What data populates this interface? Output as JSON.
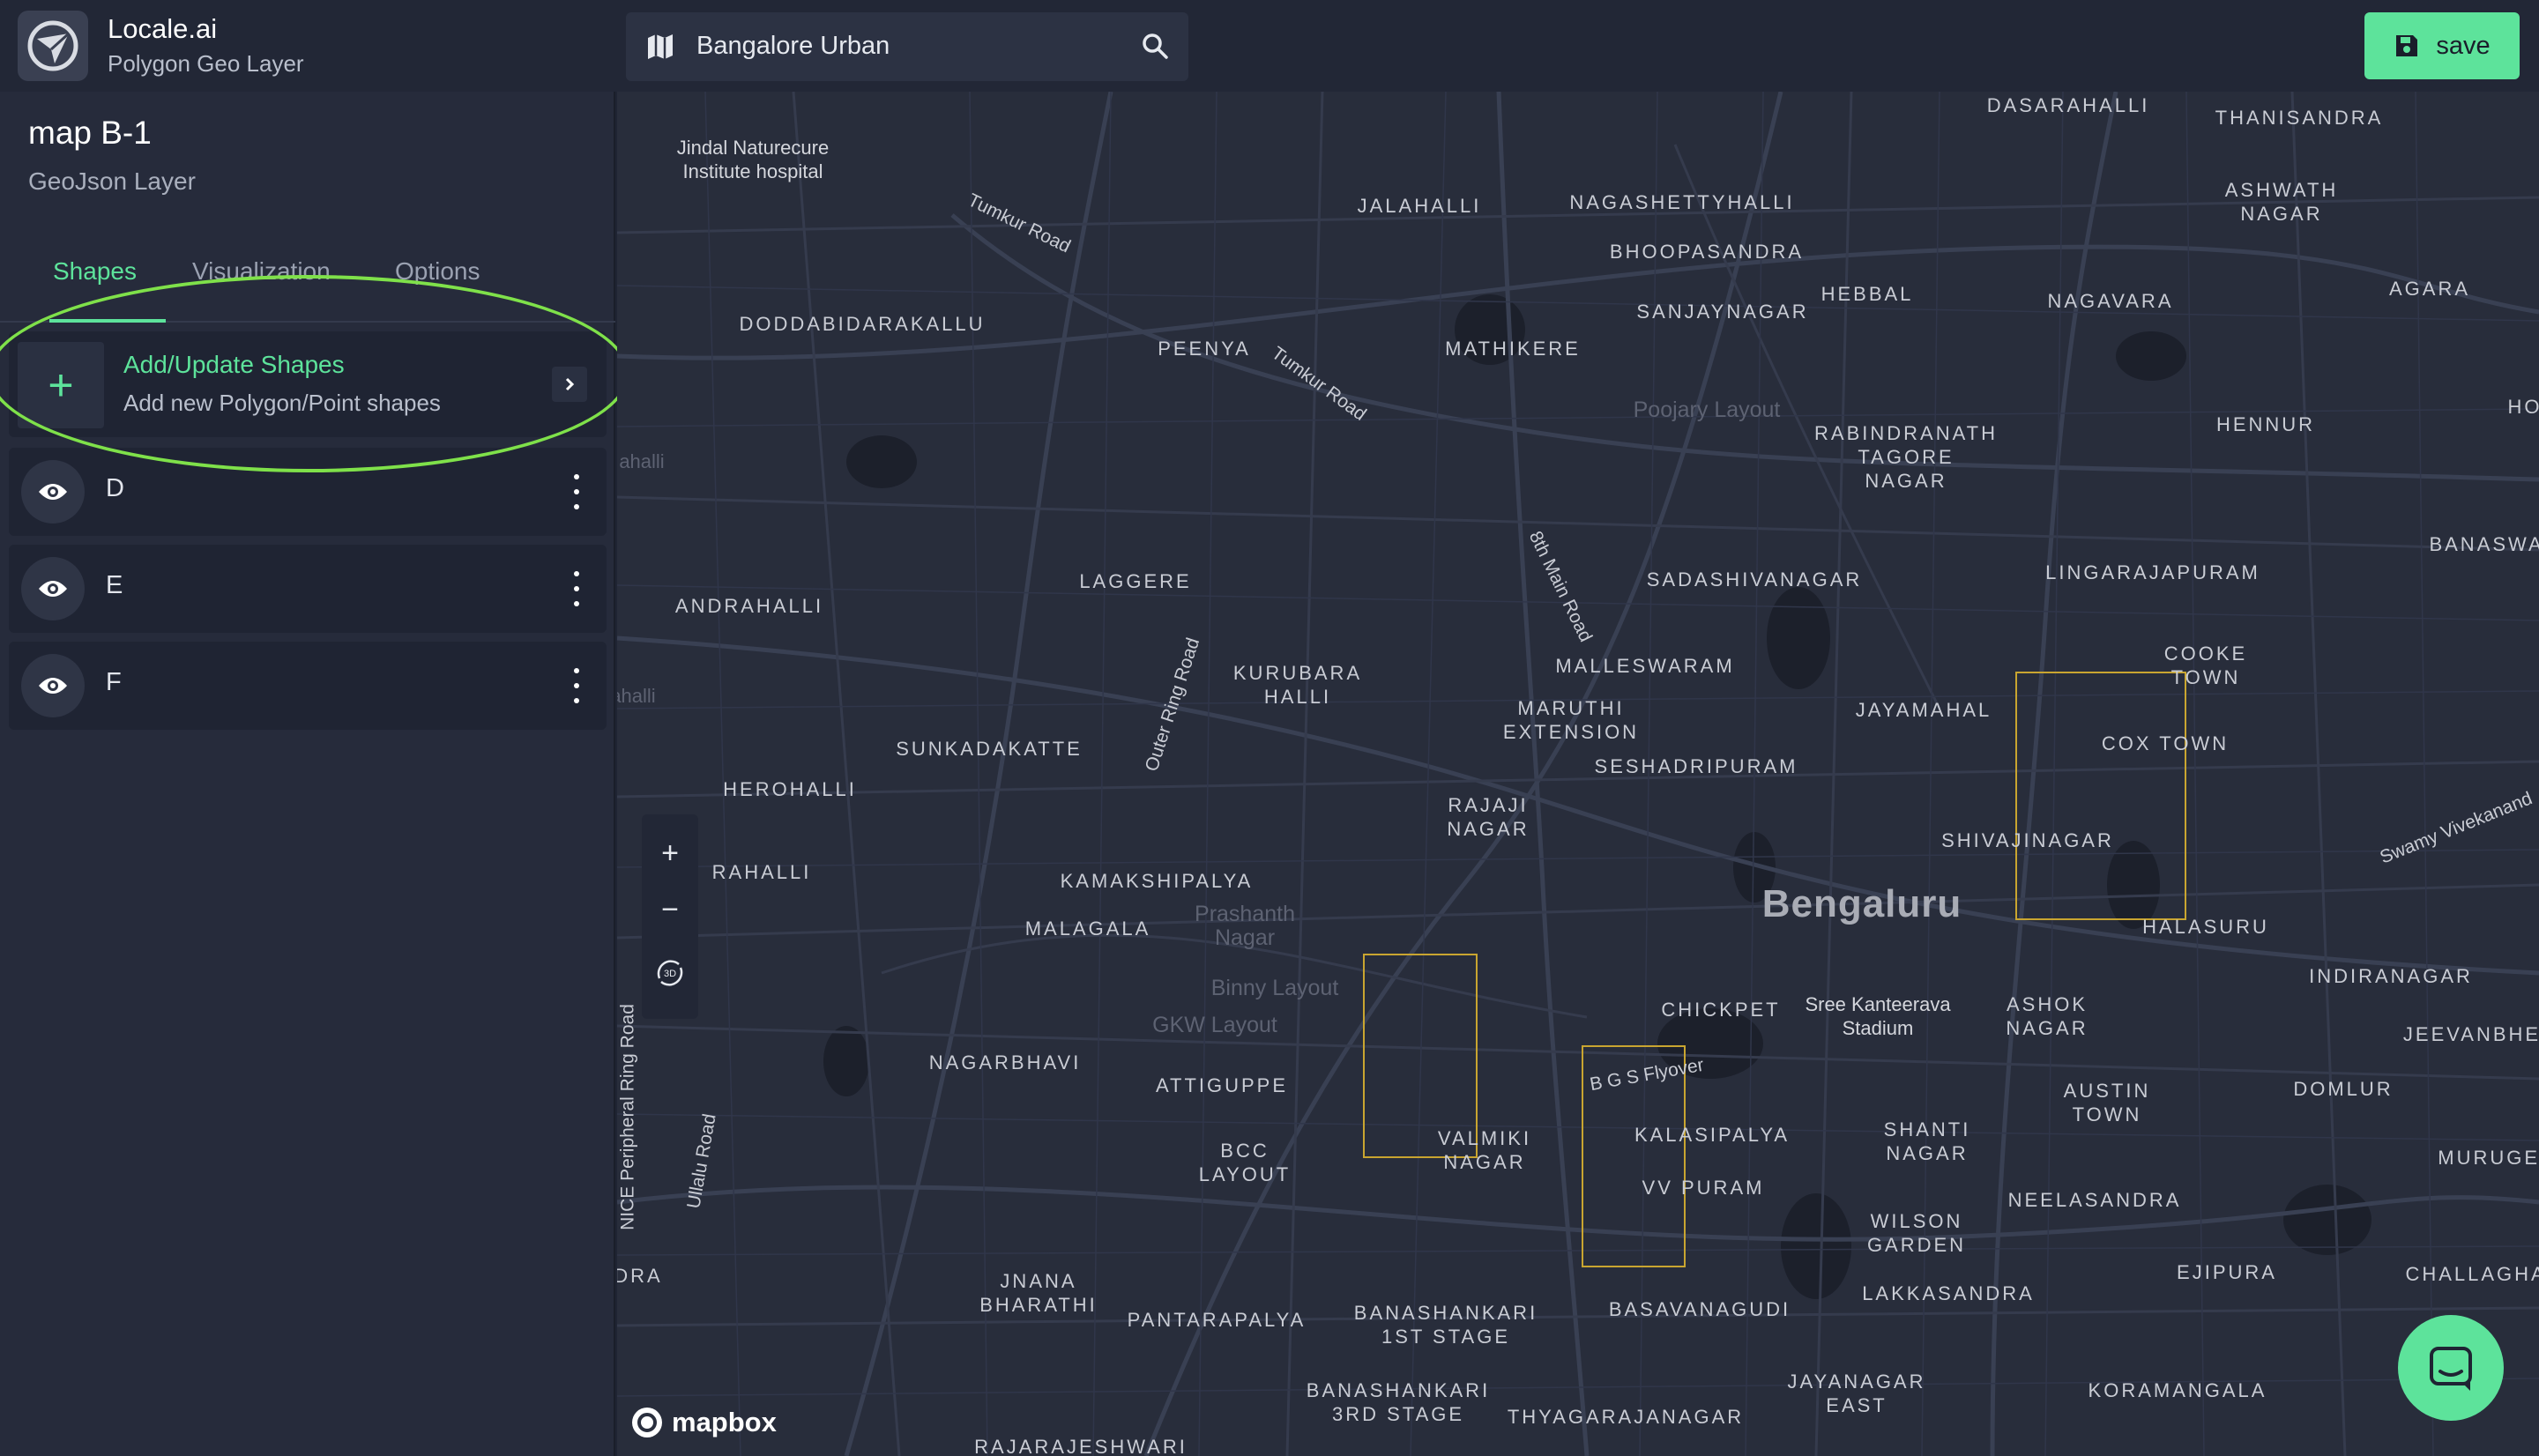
{
  "app": {
    "name": "Locale.ai",
    "subtitle": "Polygon Geo Layer"
  },
  "layer": {
    "title": "map B-1",
    "type": "GeoJson Layer"
  },
  "tabs": [
    {
      "label": "Shapes",
      "active": true
    },
    {
      "label": "Visualization",
      "active": false
    },
    {
      "label": "Options",
      "active": false
    }
  ],
  "add_shapes": {
    "title": "Add/Update Shapes",
    "subtitle": "Add new Polygon/Point shapes",
    "icon": "plus-icon"
  },
  "shapes": [
    {
      "label": "D",
      "visible": true
    },
    {
      "label": "E",
      "visible": true
    },
    {
      "label": "F",
      "visible": true
    }
  ],
  "search": {
    "value": "Bangalore Urban",
    "icon": "search-icon"
  },
  "save_button": {
    "label": "save",
    "color": "#5de39b"
  },
  "map": {
    "attribution": "mapbox",
    "labels": {
      "dasarahalli": "DASARAHALLI",
      "thanisandra": "THANISANDRA",
      "jindal": "Jindal Naturecure\nInstitute hospital",
      "tumkur_road_1": "Tumkur Road",
      "jalahalli": "JALAHALLI",
      "nagashettyhalli": "NAGASHETTYHALLI",
      "ashwath_nagar": "ASHWATH\nNAGAR",
      "bhoopasandra": "BHOOPASANDRA",
      "hebbal": "HEBBAL",
      "nagavara": "NAGAVARA",
      "agara": "AGARA",
      "doddabidarakallu": "DODDABIDARAKALLU",
      "peenya": "PEENYA",
      "tumkur_road_2": "Tumkur Road",
      "mathikere": "MATHIKERE",
      "sanjaynagar": "SANJAYNAGAR",
      "poojary_layout": "Poojary Layout",
      "rabindranath": "RABINDRANATH\nTAGORE\nNAGAR",
      "hennur": "HENNUR",
      "ho": "HO",
      "halli_1": "ahalli",
      "main_road": "8th Main Road",
      "banaswadi": "BANASWAD",
      "laggere": "LAGGERE",
      "sadashivanagar": "SADASHIVANAGAR",
      "lingarajapuram": "LINGARAJAPURAM",
      "andrahalli": "ANDRAHALLI",
      "outer_ring_road": "Outer Ring Road",
      "kurubara_halli": "KURUBARA\nHALLI",
      "malleswaram": "MALLESWARAM",
      "cooke_town": "COOKE\nTOWN",
      "halli_2": "ahalli",
      "maruthi_extension": "MARUTHI\nEXTENSION",
      "jayamahal": "JAYAMAHAL",
      "cox_town": "COX TOWN",
      "sunkadakatte": "SUNKADAKATTE",
      "seshadripuram": "SESHADRIPURAM",
      "herohalli": "HEROHALLI",
      "rajaji_nagar": "RAJAJI\nNAGAR",
      "shivajinagar": "SHIVAJINAGAR",
      "swamy_vivekananda": "Swamy Vivekanand",
      "rahalli": "RAHALLI",
      "kamakshipalya": "KAMAKSHIPALYA",
      "prashanth_nagar": "Prashanth\nNagar",
      "bengaluru": "Bengaluru",
      "halasuru": "HALASURU",
      "malagala": "MALAGALA",
      "binny_layout": "Binny Layout",
      "indiranagar": "INDIRANAGAR",
      "gkw_layout": "GKW Layout",
      "chickpet": "CHICKPET",
      "kanteerava": "Sree Kanteerava\nStadium",
      "ashok_nagar": "ASHOK\nNAGAR",
      "jeevanbhe": "JEEVANBHE",
      "nagarbhavi": "NAGARBHAVI",
      "bgs_flyover": "B G S Flyover",
      "attiguppe": "ATTIGUPPE",
      "austin_town": "AUSTIN\nTOWN",
      "domlur": "DOMLUR",
      "nice_road": "NICE Peripheral Ring Road",
      "ullalu_road": "Ullalu Road",
      "kalasipalya": "KALASIPALYA",
      "shanti_nagar": "SHANTI\nNAGAR",
      "valmiki_nagar": "VALMIKI\nNAGAR",
      "bcc_layout": "BCC\nLAYOUT",
      "murugesh": "MURUGES",
      "vv_puram": "VV PURAM",
      "neelasandra": "NEELASANDRA",
      "wilson_garden": "WILSON\nGARDEN",
      "dra": "DRA",
      "ejipura": "EJIPURA",
      "challaghatta": "CHALLAGHAT",
      "jnana_bharathi": "JNANA\nBHARATHI",
      "lakkasandra": "LAKKASANDRA",
      "basavanagudi": "BASAVANAGUDI",
      "pantarapalya": "PANTARAPALYA",
      "banashankari_1": "BANASHANKARI\n1ST STAGE",
      "jayanagar_east": "JAYANAGAR\nEAST",
      "koramangala": "KORAMANGALA",
      "banashankari_3": "BANASHANKARI\n3RD STAGE",
      "thyagarajanagar": "THYAGARAJANAGAR",
      "rajarajeshwari": "RAJARAJESHWARI"
    },
    "shape_outline_color": "#c9a530"
  },
  "map_controls": {
    "zoom_in": "+",
    "zoom_out": "−",
    "pitch": "3D"
  }
}
